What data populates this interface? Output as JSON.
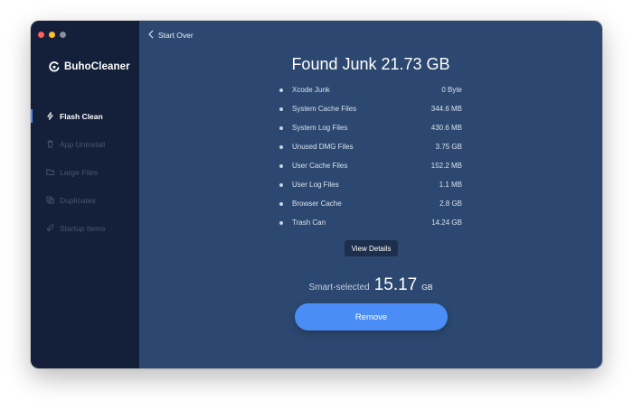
{
  "app": {
    "name": "BuhoCleaner"
  },
  "colors": {
    "sidebar_bg": "#142039",
    "main_bg": "#2c4870",
    "accent": "#4a8df6",
    "traffic_red": "#fe5f57",
    "traffic_yellow": "#febc2e",
    "traffic_gray": "#8a8f98"
  },
  "sidebar": {
    "items": [
      {
        "label": "Flash Clean",
        "icon": "lightning-icon",
        "active": true
      },
      {
        "label": "App Uninstall",
        "icon": "trash-icon",
        "active": false
      },
      {
        "label": "Large Files",
        "icon": "folder-icon",
        "active": false
      },
      {
        "label": "Duplicates",
        "icon": "duplicate-icon",
        "active": false
      },
      {
        "label": "Startup Items",
        "icon": "rocket-icon",
        "active": false
      }
    ]
  },
  "main": {
    "back_label": "Start Over",
    "title": "Found Junk 21.73 GB",
    "junk_items": [
      {
        "name": "Xcode Junk",
        "size": "0 Byte"
      },
      {
        "name": "System Cache Files",
        "size": "344.6 MB"
      },
      {
        "name": "System Log Files",
        "size": "430.6 MB"
      },
      {
        "name": "Unused DMG Files",
        "size": "3.75 GB"
      },
      {
        "name": "User Cache Files",
        "size": "152.2 MB"
      },
      {
        "name": "User Log Files",
        "size": "1.1 MB"
      },
      {
        "name": "Browser Cache",
        "size": "2.8 GB"
      },
      {
        "name": "Trash Can",
        "size": "14.24 GB"
      }
    ],
    "view_details_label": "View Details",
    "smart_selected_label": "Smart-selected",
    "smart_selected_value": "15.17",
    "smart_selected_unit": "GB",
    "remove_label": "Remove"
  }
}
